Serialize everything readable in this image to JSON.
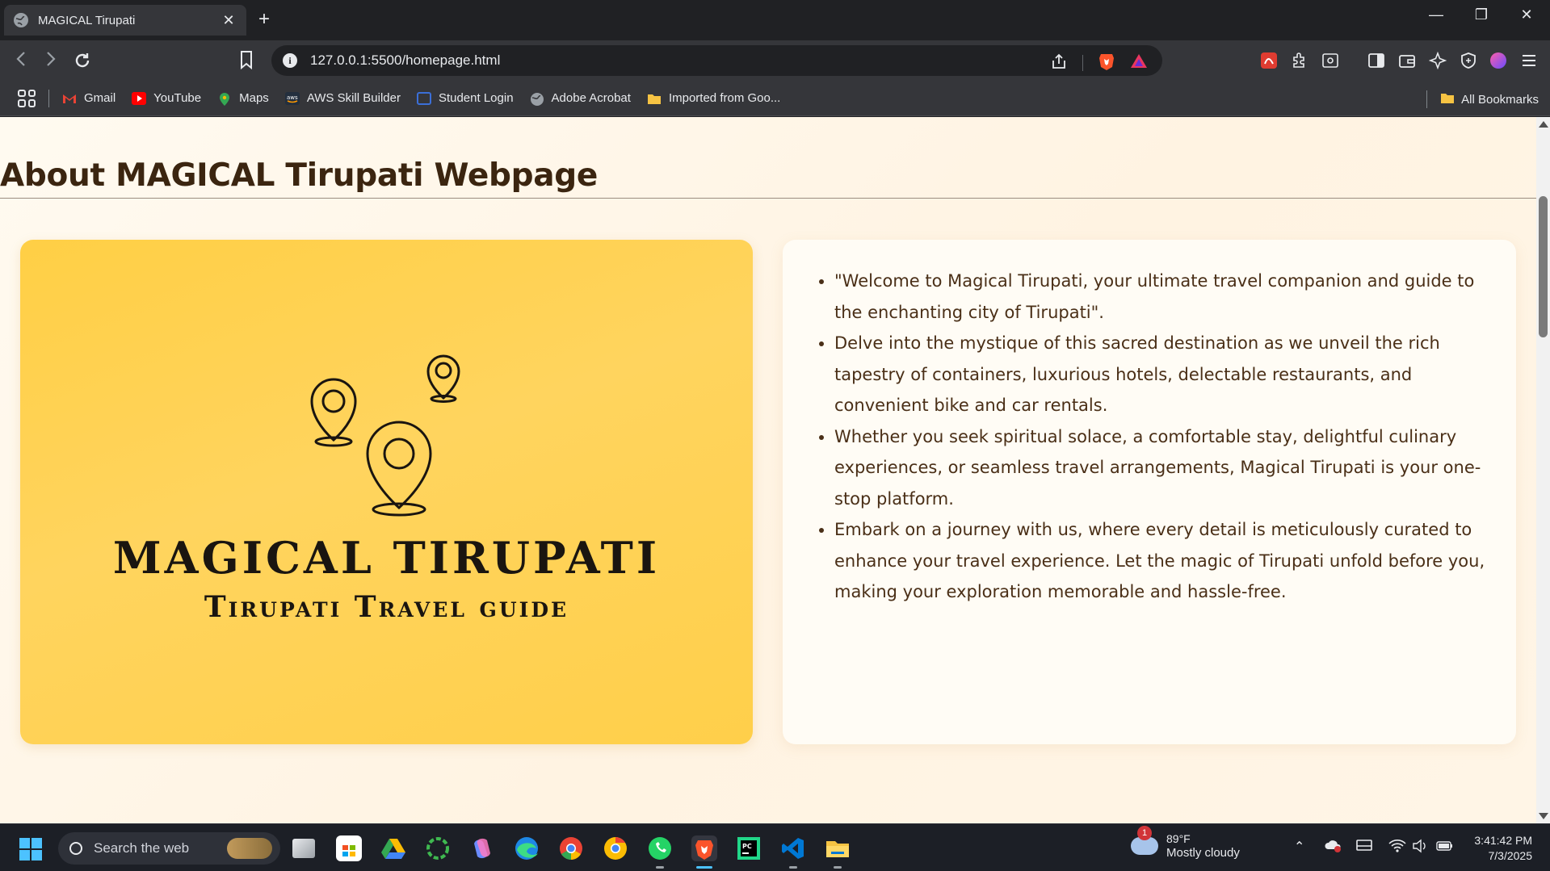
{
  "browser": {
    "tab_title": "MAGICAL Tirupati",
    "tab_close": "✕",
    "new_tab": "+",
    "url": "127.0.0.1:5500/homepage.html"
  },
  "bookmarks": {
    "items": [
      {
        "label": "Gmail",
        "color": "#ea4335"
      },
      {
        "label": "YouTube",
        "color": "#ff0000"
      },
      {
        "label": "Maps",
        "color": "#34a853"
      },
      {
        "label": "AWS Skill Builder",
        "color": "#232f3e"
      },
      {
        "label": "Student Login",
        "color": "#3b6fd8"
      },
      {
        "label": "Adobe Acrobat",
        "color": "#9aa0a6"
      },
      {
        "label": "Imported from Goo...",
        "color": "#f6c343"
      }
    ],
    "all_bookmarks": "All Bookmarks"
  },
  "page": {
    "heading": "About MAGICAL Tirupati Webpage",
    "logo_title": "MAGICAL TIRUPATI",
    "logo_subtitle": "Tirupati Travel guide",
    "bullets": [
      "\"Welcome to Magical Tirupati, your ultimate travel companion and guide to the enchanting city of Tirupati\".",
      "Delve into the mystique of this sacred destination as we unveil the rich tapestry of containers, luxurious hotels, delectable restaurants, and convenient bike and car rentals.",
      "Whether you seek spiritual solace, a comfortable stay, delightful culinary experiences, or seamless travel arrangements, Magical Tirupati is your one-stop platform.",
      "Embark on a journey with us, where every detail is meticulously curated to enhance your travel experience. Let the magic of Tirupati unfold before you, making your exploration memorable and hassle-free."
    ],
    "accent_color": "#ffd04d",
    "text_color": "#4a2f17"
  },
  "taskbar": {
    "search_placeholder": "Search the web",
    "weather_badge": "1",
    "weather_temp": "89°F",
    "weather_condition": "Mostly cloudy",
    "time": "3:41:42 PM",
    "date": "7/3/2025"
  }
}
